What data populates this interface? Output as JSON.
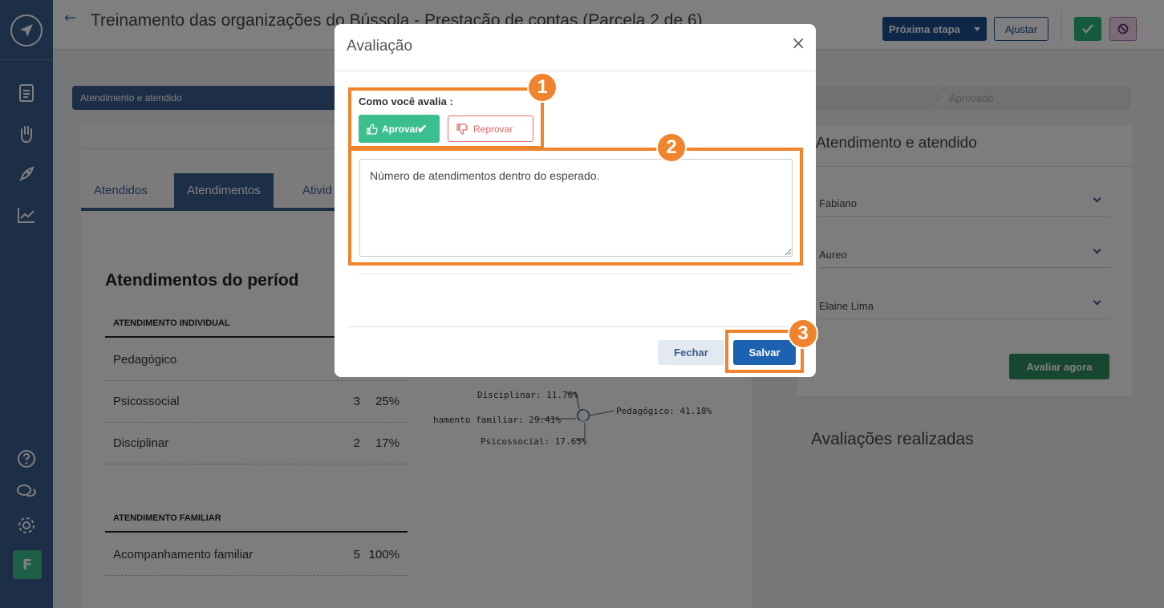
{
  "header": {
    "title": "Treinamento das organizações do Bússola - Prestação de contas (Parcela 2 de 6)",
    "next_step_label": "Próxima etapa",
    "adjust_label": "Ajustar"
  },
  "sidebar": {
    "avatar_initial": "F",
    "icons": [
      "logo-icon",
      "document-icon",
      "hand-heart-icon",
      "rocket-icon",
      "chart-icon",
      "help-icon",
      "chat-icon",
      "gear-icon"
    ]
  },
  "steps": {
    "active": "Atendimento e atendido",
    "last": "Aprovado"
  },
  "tabs": [
    {
      "label": "Atendidos"
    },
    {
      "label": "Atendimentos"
    },
    {
      "label": "Ativid"
    }
  ],
  "section_title": "Atendimentos do períod",
  "individual": {
    "header": "ATENDIMENTO INDIVIDUAL",
    "rows": [
      {
        "name": "Pedagógico",
        "count": "",
        "pct": ""
      },
      {
        "name": "Psicossocial",
        "count": "3",
        "pct": "25%"
      },
      {
        "name": "Disciplinar",
        "count": "2",
        "pct": "17%"
      }
    ]
  },
  "family": {
    "header": "ATENDIMENTO FAMILIAR",
    "rows": [
      {
        "name": "Acompanhamento familiar",
        "count": "5",
        "pct": "100%"
      }
    ]
  },
  "chart_data": {
    "type": "pie",
    "title": "",
    "slices": [
      {
        "label": "Disciplinar: 11.76%",
        "value": 11.76
      },
      {
        "label": "hamento familiar: 29.41%",
        "value": 29.41
      },
      {
        "label": "Psicossocial: 17.65%",
        "value": 17.65
      },
      {
        "label": "Pedagógico: 41.18%",
        "value": 41.18
      }
    ]
  },
  "right_panel": {
    "title": "Atendimento e atendido",
    "people": [
      "Fabiano",
      "Aureo",
      "Elaine Lima"
    ],
    "evaluate_label": "Avaliar agora",
    "reviews_title": "Avaliações realizadas"
  },
  "modal": {
    "title": "Avaliação",
    "close_symbol": "×",
    "question": "Como você avalia :",
    "approve_label": "Aprovar",
    "reject_label": "Reprovar",
    "comment": "Número de atendimentos dentro do esperado.",
    "close_label": "Fechar",
    "save_label": "Salvar"
  },
  "callouts": [
    "1",
    "2",
    "3"
  ],
  "colors": {
    "sidebar": "#3b5d8f",
    "approve": "#3bbf8f",
    "reject": "#e06a6a",
    "primary": "#1c62b0",
    "callout": "#f0842c"
  }
}
